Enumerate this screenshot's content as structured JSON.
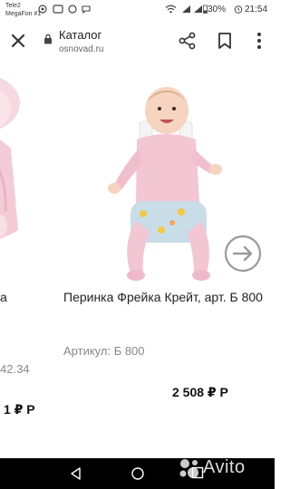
{
  "status_bar": {
    "carrier_line1": "Tele2",
    "carrier_line2": "MegaFon #1",
    "battery": "30%",
    "time": "21:54"
  },
  "browser": {
    "title": "Каталог",
    "url": "osnovad.ru"
  },
  "carousel": {
    "prev_item": {
      "title_fragment": "а",
      "article_fragment": "42.34",
      "price_fragment": "1 ₽ Р"
    },
    "current_item": {
      "title": "Перинка Фрейка Крейт, арт. Б 800",
      "article": "Артикул: Б 800",
      "price": "2 508 ₽ Р"
    }
  },
  "watermark": {
    "brand": "Avito"
  },
  "colors": {
    "pink": "#f3c6d3",
    "pillow_blue": "#c9dde9",
    "straps": "#f2f2f2",
    "nav_bg": "#000000"
  }
}
